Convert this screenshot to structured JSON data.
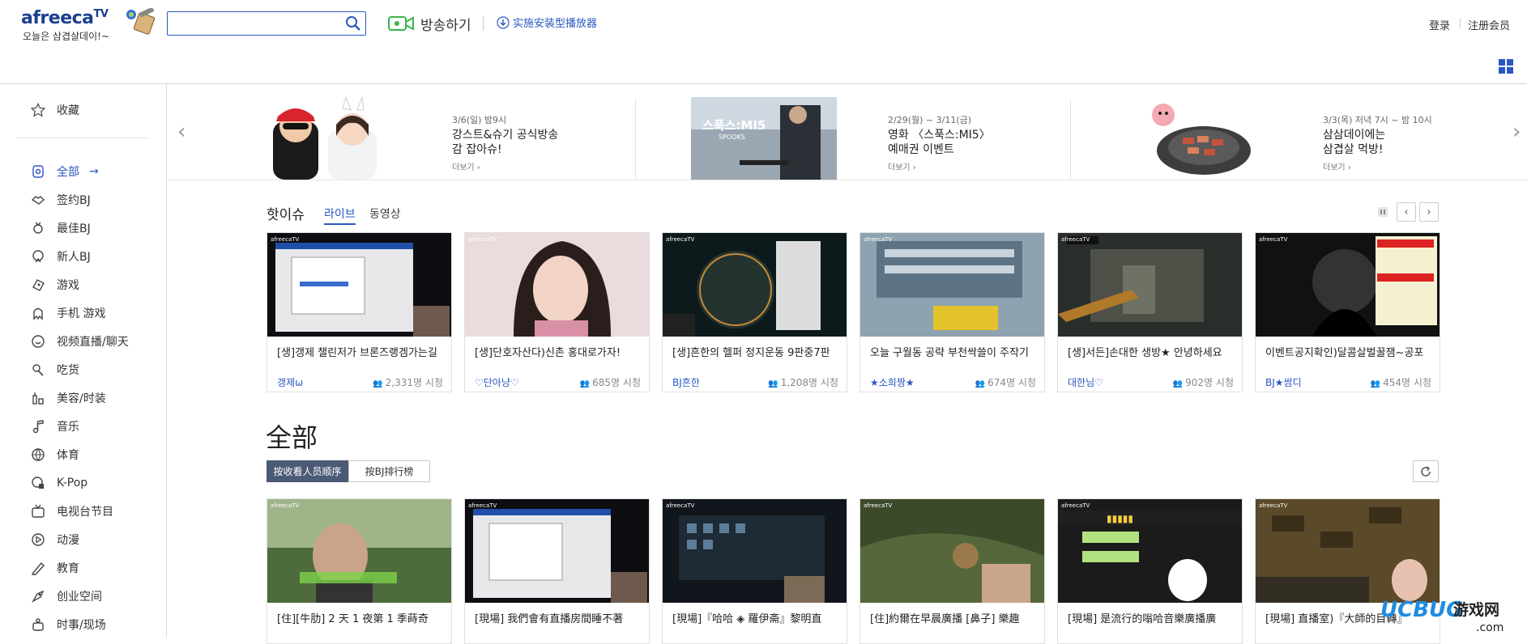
{
  "header": {
    "logo_text": "afreeca",
    "logo_tv": "TV",
    "logo_subtitle": "오늘은 삼겹살데이!~",
    "search_placeholder": "",
    "broadcast_label": "방송하기",
    "install_label": "实施安装型播放器",
    "login_label": "登录",
    "register_label": "注册会员"
  },
  "sidebar": {
    "favorites_label": "收藏",
    "items": [
      {
        "label": "全部",
        "icon": "all-icon",
        "active": true
      },
      {
        "label": "签约BJ",
        "icon": "handshake-icon"
      },
      {
        "label": "最佳BJ",
        "icon": "medal-icon"
      },
      {
        "label": "新人BJ",
        "icon": "rookie-icon"
      },
      {
        "label": "游戏",
        "icon": "game-icon"
      },
      {
        "label": "手机 游戏",
        "icon": "mobile-game-icon"
      },
      {
        "label": "视频直播/聊天",
        "icon": "smile-icon"
      },
      {
        "label": "吃货",
        "icon": "food-icon"
      },
      {
        "label": "美容/时装",
        "icon": "beauty-icon"
      },
      {
        "label": "音乐",
        "icon": "music-icon"
      },
      {
        "label": "体育",
        "icon": "sports-icon"
      },
      {
        "label": "K-Pop",
        "icon": "kpop-icon"
      },
      {
        "label": "电视台节目",
        "icon": "tv-icon"
      },
      {
        "label": "动漫",
        "icon": "play-icon"
      },
      {
        "label": "教育",
        "icon": "education-icon"
      },
      {
        "label": "创业空间",
        "icon": "startup-icon"
      },
      {
        "label": "时事/现场",
        "icon": "news-icon"
      }
    ]
  },
  "banners": [
    {
      "date": "3/6(일) 밤9시",
      "title1": "강스트&슈기 공식방송",
      "title2": "감 잡아슈!",
      "more": "더보기 ›"
    },
    {
      "date": "2/29(월) ~ 3/11(금)",
      "title1": "영화 〈스푹스:MI5〉",
      "title2": "예매권 이벤트",
      "more": "더보기 ›",
      "poster_text": "스푹스:MI5",
      "poster_sub": "SPOOKS"
    },
    {
      "date": "3/3(목) 저녁 7시 ~ 밤 10시",
      "title1": "삼삼데이에는",
      "title2": "삼겹살 먹방!",
      "more": "더보기 ›"
    }
  ],
  "hot": {
    "title": "핫이슈",
    "tab_live": "라이브",
    "tab_vod": "동영상",
    "cards": [
      {
        "title": "[생]갱제 챌린저가 브론즈랭겜가는길",
        "bj": "갱제ω",
        "views": "2,331명 시청"
      },
      {
        "title": "[생]단호자산다)신촌 홍대로가자!",
        "bj": "♡단아냥♡",
        "views": "685명 시청"
      },
      {
        "title": "[생]흔한의 헬퍼 정지운동 9판중7판",
        "bj": "BJ흔한",
        "views": "1,208명 시청"
      },
      {
        "title": "오늘 구월동 공략 부천싹쓸이 주작기",
        "bj": "★소희짱★",
        "views": "674명 시청"
      },
      {
        "title": "[생]서든]손대한 생방★ 안녕하세요",
        "bj": "대한님♡",
        "views": "902명 시청"
      },
      {
        "title": "이벤트공지확인)달콤살벌꿀잼~공포",
        "bj": "BJ★쌈디",
        "views": "454명 시청"
      }
    ]
  },
  "all": {
    "title": "全部",
    "sort_viewers": "按收看人员顺序",
    "sort_bj": "按BJ排行榜",
    "cards": [
      {
        "title": "[住][牛肋] 2 天 1 夜第 1 季蒔奇"
      },
      {
        "title": "[現場] 我們會有直播房間睡不著"
      },
      {
        "title": "[現場]『哈哈 ◈ 羅伊斋』黎明直"
      },
      {
        "title": "[住]約爾在早晨廣播 [鼻子] 樂趣"
      },
      {
        "title": "[現場] 是流行的嗡哈音樂廣播廣"
      },
      {
        "title": "[現場] 直播室)『大師的目轉』"
      }
    ]
  },
  "watermark": {
    "text": "UCBUG游戏网",
    "domain": ".com"
  },
  "colors": {
    "accent": "#2a57c1",
    "sort_active": "#4b5a75"
  }
}
